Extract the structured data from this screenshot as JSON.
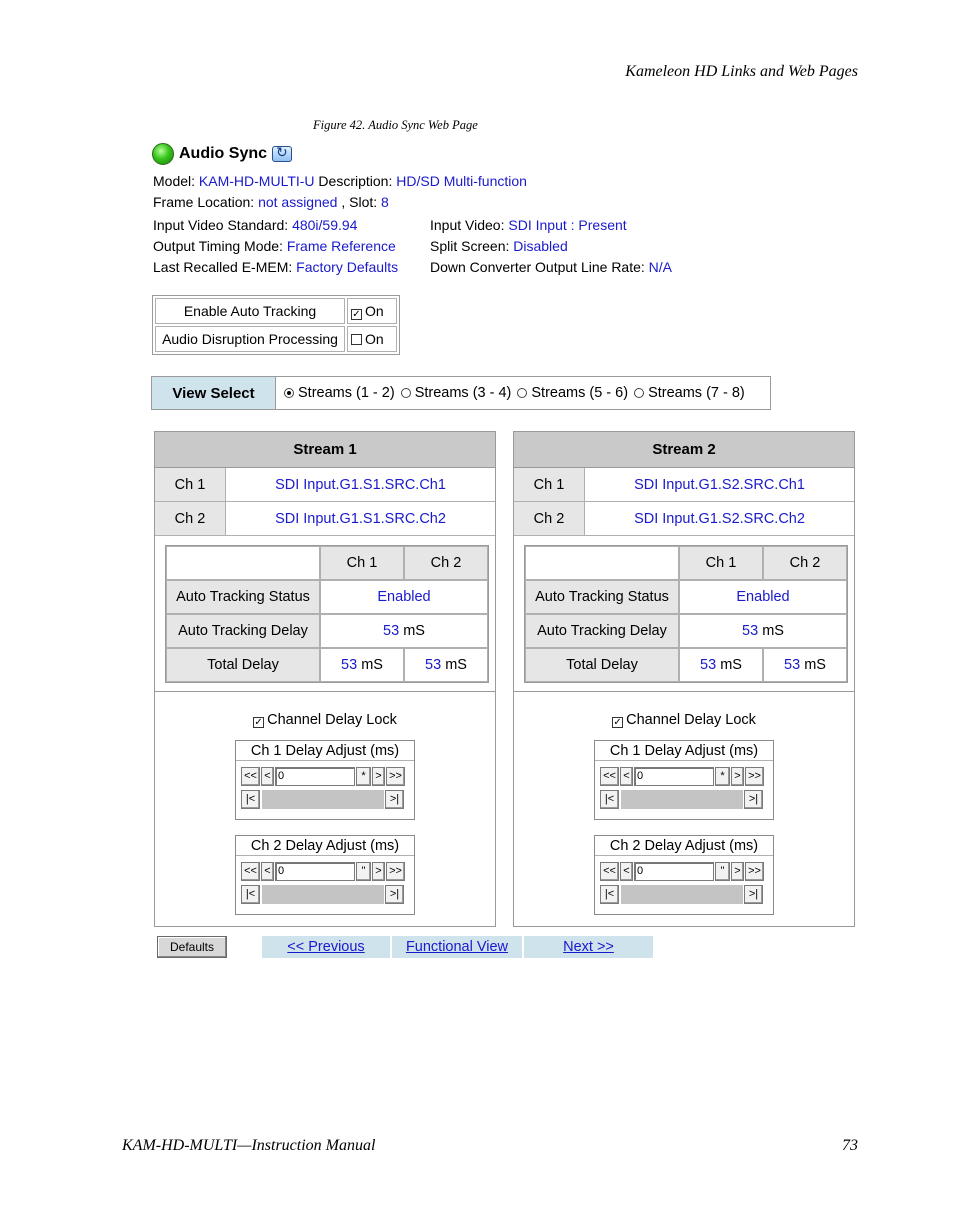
{
  "header": {
    "running_title": "Kameleon HD Links and Web Pages"
  },
  "figure": {
    "caption": "Figure 42.  Audio Sync Web Page"
  },
  "page": {
    "title": "Audio Sync",
    "info": {
      "model_label": "Model: ",
      "model_value": "KAM-HD-MULTI-U",
      "desc_label": " Description: ",
      "desc_value": "HD/SD Multi-function",
      "frame_label": "Frame Location: ",
      "frame_value": "not assigned",
      "slot_label": " , Slot: ",
      "slot_value": "8",
      "ivs_label": "Input Video Standard: ",
      "ivs_value": "480i/59.94",
      "otm_label": "Output Timing Mode: ",
      "otm_value": "Frame Reference",
      "lre_label": "Last Recalled E-MEM: ",
      "lre_value": "Factory Defaults",
      "iv_label": "Input Video: ",
      "iv_value": "SDI Input : Present",
      "ss_label": "Split Screen: ",
      "ss_value": "Disabled",
      "dc_label": "Down Converter Output Line Rate: ",
      "dc_value": "N/A"
    },
    "settings": {
      "auto_tracking_label": "Enable Auto Tracking",
      "auto_tracking_value": "On",
      "auto_tracking_mark": "✓",
      "disruption_label": "Audio Disruption Processing",
      "disruption_value": "On",
      "disruption_mark": ""
    },
    "view_select": {
      "label": "View Select",
      "options": [
        "Streams (1 - 2)",
        "Streams (3 - 4)",
        "Streams (5 - 6)",
        "Streams (7 - 8)"
      ],
      "selected": "Streams (1 - 2)"
    },
    "streams": [
      {
        "title": "Stream 1",
        "ch1_label": "Ch 1",
        "ch1_source": "SDI Input.G1.S1.SRC.Ch1",
        "ch2_label": "Ch 2",
        "ch2_source": "SDI Input.G1.S1.SRC.Ch2",
        "col_ch1": "Ch 1",
        "col_ch2": "Ch 2",
        "ats_label": "Auto Tracking Status",
        "ats_value": "Enabled",
        "atd_label": "Auto Tracking Delay",
        "atd_num": "53",
        "atd_unit": " mS",
        "td_label": "Total Delay",
        "td1_num": "53",
        "td1_unit": " mS",
        "td2_num": "53",
        "td2_unit": " mS",
        "lock_label": "Channel Delay Lock",
        "lock_mark": "✓",
        "adj1_title": "Ch 1 Delay Adjust (ms)",
        "adj1_value": "0",
        "adj2_title": "Ch 2 Delay Adjust (ms)",
        "adj2_value": "0"
      },
      {
        "title": "Stream 2",
        "ch1_label": "Ch 1",
        "ch1_source": "SDI Input.G1.S2.SRC.Ch1",
        "ch2_label": "Ch 2",
        "ch2_source": "SDI Input.G1.S2.SRC.Ch2",
        "col_ch1": "Ch 1",
        "col_ch2": "Ch 2",
        "ats_label": "Auto Tracking Status",
        "ats_value": "Enabled",
        "atd_label": "Auto Tracking Delay",
        "atd_num": "53",
        "atd_unit": " mS",
        "td_label": "Total Delay",
        "td1_num": "53",
        "td1_unit": " mS",
        "td2_num": "53",
        "td2_unit": " mS",
        "lock_label": "Channel Delay Lock",
        "lock_mark": "✓",
        "adj1_title": "Ch 1 Delay Adjust (ms)",
        "adj1_value": "0",
        "adj2_title": "Ch 2 Delay Adjust (ms)",
        "adj2_value": "0"
      }
    ],
    "controls": {
      "fast_back": "<<",
      "back": "<",
      "forward": ">",
      "fast_forward": ">>",
      "star": "*",
      "quote": "\"",
      "slider_min": "|<",
      "slider_max": ">|"
    },
    "buttons": {
      "defaults": "Defaults",
      "previous": "<< Previous",
      "functional_view": "Functional View",
      "next": "Next >>"
    }
  },
  "footer": {
    "manual": "KAM-HD-MULTI—Instruction Manual",
    "page_number": "73"
  },
  "colors": {
    "link": "#1a1acc",
    "header_band": "#cfe3ec",
    "panel_head": "#c9c9c9",
    "status_led": "#37c51c"
  }
}
